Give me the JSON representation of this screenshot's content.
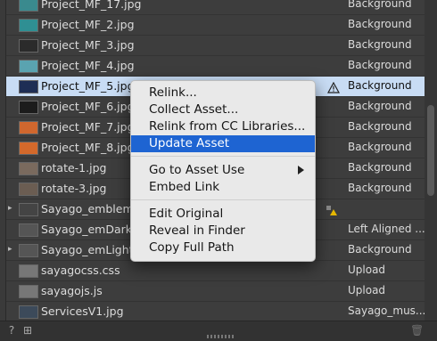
{
  "assets": [
    {
      "name": "Project_MF_17.jpg",
      "layer": "Background",
      "thumb": "#3a8a8e"
    },
    {
      "name": "Project_MF_2.jpg",
      "layer": "Background",
      "thumb": "#2f8f93"
    },
    {
      "name": "Project_MF_3.jpg",
      "layer": "Background",
      "thumb": "#2b2b2b"
    },
    {
      "name": "Project_MF_4.jpg",
      "layer": "Background",
      "thumb": "#5aa3b0"
    },
    {
      "name": "Project_MF_5.jpg",
      "layer": "Background",
      "thumb": "#1e2e55",
      "selected": true,
      "warning": true
    },
    {
      "name": "Project_MF_6.jpg",
      "layer": "Background",
      "thumb": "#1c1c1c"
    },
    {
      "name": "Project_MF_7.jpg",
      "layer": "Background",
      "thumb": "#d0672e"
    },
    {
      "name": "Project_MF_8.jpg",
      "layer": "Background",
      "thumb": "#d4692b"
    },
    {
      "name": "rotate-1.jpg",
      "layer": "Background",
      "thumb": "#7a6a5e"
    },
    {
      "name": "rotate-3.jpg",
      "layer": "Background",
      "thumb": "#6b5d52"
    },
    {
      "name": "Sayago_emblem_SM",
      "layer": "",
      "thumb": "#444444",
      "expandable": true,
      "warning2": true
    },
    {
      "name": "Sayago_emDark_hea",
      "layer": "Left Aligned ...",
      "thumb": "#555555"
    },
    {
      "name": "Sayago_emLight_hea",
      "layer": "Background",
      "thumb": "#555555",
      "expandable": true
    },
    {
      "name": "sayagocss.css",
      "layer": "Upload",
      "thumb": "#777777"
    },
    {
      "name": "sayagojs.js",
      "layer": "Upload",
      "thumb": "#777777"
    },
    {
      "name": "ServicesV1.jpg",
      "layer": "Sayago_mus...",
      "thumb": "#3c4a5a"
    }
  ],
  "menu": {
    "items": [
      {
        "label": "Relink..."
      },
      {
        "label": "Collect Asset..."
      },
      {
        "label": "Relink from CC Libraries..."
      },
      {
        "label": "Update Asset",
        "highlighted": true
      },
      {
        "sep": true
      },
      {
        "label": "Go to Asset Use",
        "submenu": true
      },
      {
        "label": "Embed Link"
      },
      {
        "sep": true
      },
      {
        "label": "Edit Original"
      },
      {
        "label": "Reveal in Finder"
      },
      {
        "label": "Copy Full Path"
      }
    ]
  },
  "footer": {
    "help_icon": "?",
    "assets_icon": "⊞",
    "trash_icon": "🗑"
  }
}
